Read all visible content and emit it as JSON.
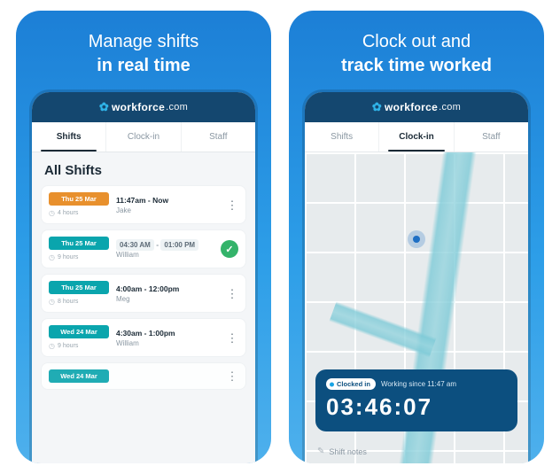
{
  "brand": {
    "name": "workforce",
    "suffix": ".com"
  },
  "tabs": {
    "shifts": "Shifts",
    "clockin": "Clock-in",
    "staff": "Staff"
  },
  "left": {
    "marketing_line1": "Manage shifts",
    "marketing_line2": "in real time",
    "section_title": "All Shifts",
    "shifts": [
      {
        "date": "Thu 25 Mar",
        "badge_color": "orange",
        "hours": "4 hours",
        "time": "11:47am - Now",
        "person": "Jake",
        "trailing": "kebab"
      },
      {
        "date": "Thu 25 Mar",
        "badge_color": "teal",
        "hours": "9 hours",
        "time_from": "04:30 AM",
        "time_to": "01:00 PM",
        "person": "William",
        "trailing": "check"
      },
      {
        "date": "Thu 25 Mar",
        "badge_color": "teal",
        "hours": "8 hours",
        "time": "4:00am - 12:00pm",
        "person": "Meg",
        "trailing": "kebab"
      },
      {
        "date": "Wed 24 Mar",
        "badge_color": "teal",
        "hours": "9 hours",
        "time": "4:30am - 1:00pm",
        "person": "William",
        "trailing": "kebab"
      },
      {
        "date": "Wed 24 Mar",
        "badge_color": "teal",
        "hours": "",
        "time": "",
        "person": "",
        "trailing": "kebab"
      }
    ]
  },
  "right": {
    "marketing_line1": "Clock out and",
    "marketing_line2": "track time worked",
    "status_pill": "Clocked in",
    "working_since": "Working since 11:47 am",
    "timer": "03:46:07",
    "notes_label": "Shift notes"
  }
}
